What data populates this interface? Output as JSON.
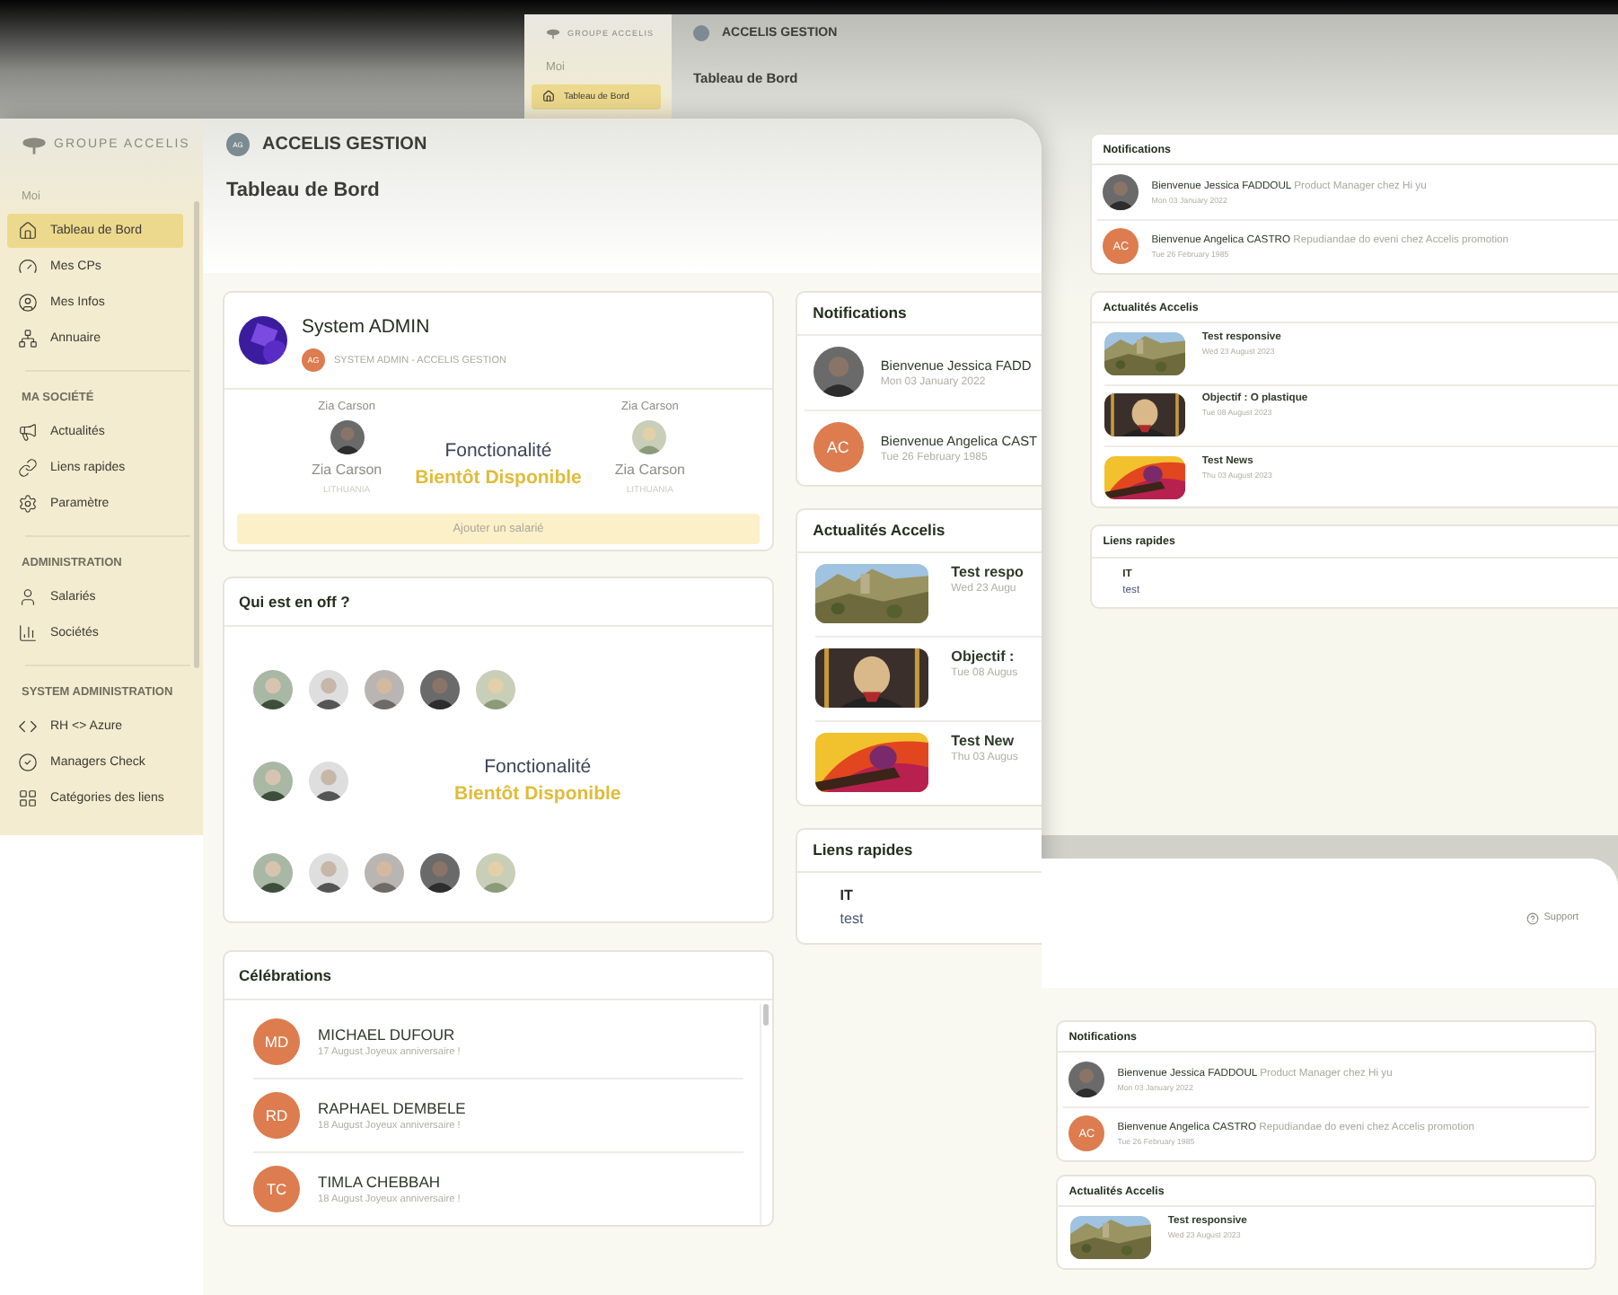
{
  "back_window": {
    "brand": "GROUPE ACCELIS",
    "app_title": "ACCELIS GESTION",
    "page_title": "Tableau de Bord",
    "sidebar": {
      "section": "Moi",
      "items": [
        {
          "label": "Tableau de Bord",
          "selected": true
        }
      ]
    },
    "notifications": {
      "title": "Notifications",
      "items": [
        {
          "kind": "picture",
          "title": "Bienvenue Jessica FADDOUL",
          "detail": "Product Manager chez Hi yu",
          "date": "Mon 03 January 2022"
        },
        {
          "kind": "initials",
          "initials": "AC",
          "title": "Bienvenue Angelica CASTRO",
          "detail": "Repudiandae do eveni chez Accelis promotion",
          "date": "Tue 26 February 1985"
        }
      ]
    },
    "news": {
      "title": "Actualités Accelis",
      "items": [
        {
          "title": "Test responsive",
          "date": "Wed 23 August 2023"
        },
        {
          "title": "Objectif : O plastique",
          "date": "Tue 08 August 2023"
        },
        {
          "title": "Test News",
          "date": "Thu 03 August 2023"
        }
      ]
    },
    "quick_links": {
      "title": "Liens rapides",
      "groups": [
        {
          "name": "IT",
          "links": [
            "test"
          ]
        }
      ]
    }
  },
  "main_window": {
    "brand": "GROUPE ACCELIS",
    "app_initials": "AG",
    "app_title": "ACCELIS GESTION",
    "page_title": "Tableau de Bord",
    "sidebar": [
      {
        "section": "Moi",
        "items": [
          {
            "label": "Tableau de Bord",
            "selected": true
          },
          {
            "label": "Mes CPs",
            "selected": false
          },
          {
            "label": "Mes Infos",
            "selected": false
          },
          {
            "label": "Annuaire",
            "selected": false
          }
        ]
      },
      {
        "section": "MA SOCIÉTÉ",
        "items": [
          {
            "label": "Actualités",
            "selected": false
          },
          {
            "label": "Liens rapides",
            "selected": false
          },
          {
            "label": "Paramètre",
            "selected": false
          }
        ]
      },
      {
        "section": "ADMINISTRATION",
        "items": [
          {
            "label": "Salariés",
            "selected": false
          },
          {
            "label": "Sociétés",
            "selected": false
          }
        ]
      },
      {
        "section": "SYSTEM ADMINISTRATION",
        "items": [
          {
            "label": "RH <> Azure",
            "selected": false
          },
          {
            "label": "Managers Check",
            "selected": false
          },
          {
            "label": "Catégories des liens",
            "selected": false
          }
        ]
      }
    ],
    "profile": {
      "name": "System ADMIN",
      "initials": "AG",
      "subtitle": "SYSTEM ADMIN - ACCELIS GESTION",
      "people": [
        {
          "label": "Zia Carson",
          "name": "Zia Carson",
          "country": "LITHUANIA"
        },
        {
          "label": "Zia Carson",
          "name": "Zia Carson",
          "country": "LITHUANIA"
        }
      ],
      "notice": {
        "line1": "Fonctionalité",
        "line2": "Bientôt Disponible"
      },
      "button": "Ajouter un salarié"
    },
    "off": {
      "title": "Qui est en off ?",
      "rows": [
        {
          "avatars": [
            {
              "kind": "picture"
            },
            {
              "kind": "picture"
            },
            {
              "kind": "picture"
            },
            {
              "kind": "picture"
            },
            {
              "kind": "picture"
            }
          ]
        },
        {
          "avatars": [
            {
              "kind": "picture"
            },
            {
              "kind": "picture"
            }
          ],
          "notice": {
            "line1": "Fonctionalité",
            "line2": "Bientôt Disponible"
          }
        },
        {
          "avatars": [
            {
              "kind": "picture"
            },
            {
              "kind": "picture"
            },
            {
              "kind": "picture"
            },
            {
              "kind": "picture"
            },
            {
              "kind": "picture"
            }
          ]
        }
      ]
    },
    "celebrations": {
      "title": "Célébrations",
      "items": [
        {
          "initials": "MD",
          "name": "MICHAEL DUFOUR",
          "detail": "17 August Joyeux anniversaire !"
        },
        {
          "initials": "RD",
          "name": "RAPHAEL DEMBELE",
          "detail": "18 August Joyeux anniversaire !"
        },
        {
          "initials": "TC",
          "name": "TIMLA CHEBBAH",
          "detail": "18 August Joyeux anniversaire !"
        }
      ]
    },
    "notifications": {
      "title": "Notifications",
      "items": [
        {
          "kind": "picture",
          "title": "Bienvenue Jessica FADD",
          "date": "Mon 03 January 2022"
        },
        {
          "kind": "initials",
          "initials": "AC",
          "title": "Bienvenue Angelica CAST",
          "date": "Tue 26 February 1985"
        }
      ]
    },
    "news": {
      "title": "Actualités Accelis",
      "items": [
        {
          "title": "Test respo",
          "date": "Wed 23 Augu"
        },
        {
          "title": "Objectif :",
          "date": "Tue 08 Augus"
        },
        {
          "title": "Test New",
          "date": "Thu 03 Augus"
        }
      ]
    },
    "quick_links": {
      "title": "Liens rapides",
      "groups": [
        {
          "name": "IT",
          "links": [
            "test"
          ]
        }
      ]
    }
  },
  "bottom_window": {
    "support": "Support",
    "notifications": {
      "title": "Notifications",
      "items": [
        {
          "kind": "picture",
          "title": "Bienvenue Jessica FADDOUL",
          "detail": "Product Manager chez Hi yu",
          "date": "Mon 03 January 2022"
        },
        {
          "kind": "initials",
          "initials": "AC",
          "title": "Bienvenue Angelica CASTRO",
          "detail": "Repudiandae do eveni chez Accelis promotion",
          "date": "Tue 26 February 1985"
        }
      ]
    },
    "news": {
      "title": "Actualités Accelis",
      "items": [
        {
          "title": "Test responsive",
          "date": "Wed 23 August 2023"
        }
      ]
    }
  }
}
